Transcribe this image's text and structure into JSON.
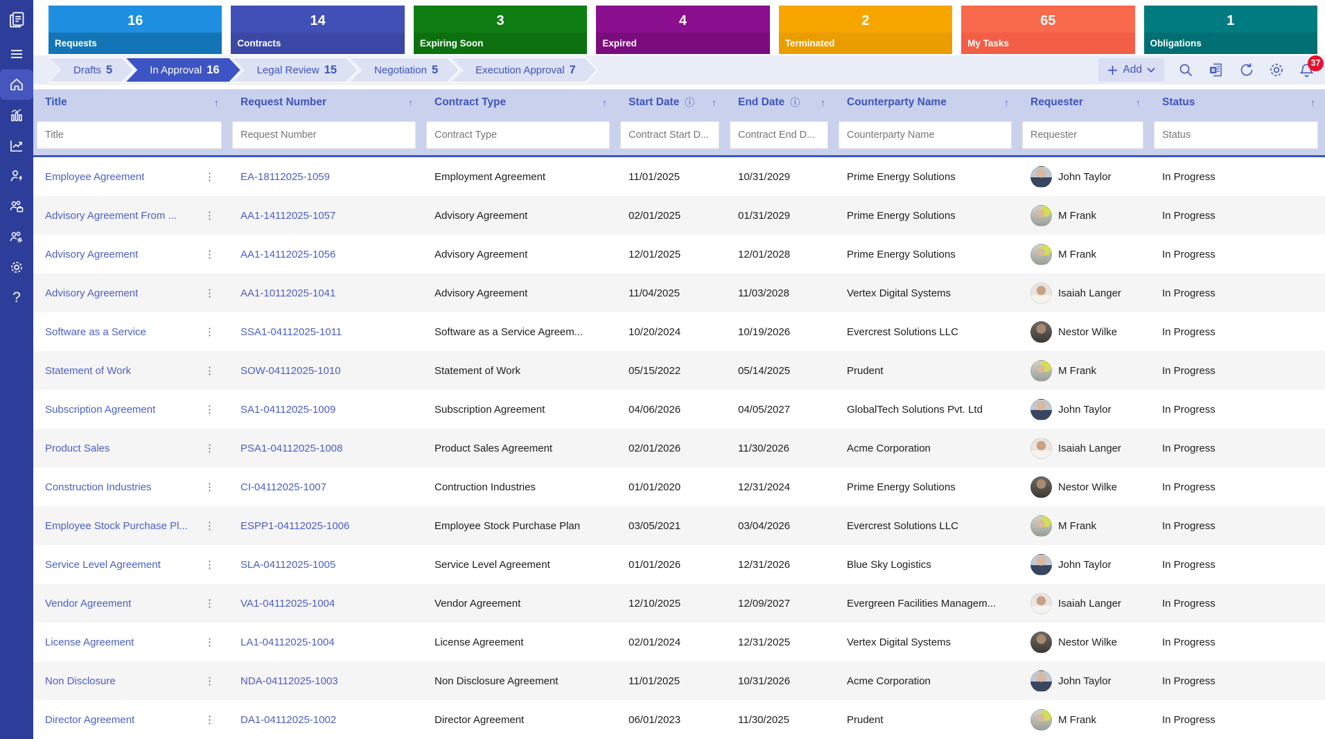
{
  "icons": {
    "sort": "↑",
    "info": "ⓘ",
    "kebab": "⋮",
    "chevron_down": "⌄",
    "plus": "+"
  },
  "sidebar": {
    "items": [
      "app-logo",
      "menu",
      "home",
      "analytics",
      "trend",
      "user-flash",
      "team-briefcase",
      "team-manage",
      "settings",
      "help"
    ],
    "active_item": "home",
    "help_glyph": "?"
  },
  "cards": [
    {
      "label": "Requests",
      "value": "16",
      "top": "#1E8FE1",
      "bottom": "#1375B5"
    },
    {
      "label": "Contracts",
      "value": "14",
      "top": "#4150B7",
      "bottom": "#3A47A5"
    },
    {
      "label": "Expiring Soon",
      "value": "3",
      "top": "#0F7E12",
      "bottom": "#0C700F"
    },
    {
      "label": "Expired",
      "value": "4",
      "top": "#8A0F8E",
      "bottom": "#7A0C7E"
    },
    {
      "label": "Terminated",
      "value": "2",
      "top": "#F7A600",
      "bottom": "#EA9D00"
    },
    {
      "label": "My Tasks",
      "value": "65",
      "top": "#F9694C",
      "bottom": "#F25F46"
    },
    {
      "label": "Obligations",
      "value": "1",
      "top": "#007B80",
      "bottom": "#006F73"
    }
  ],
  "pipeline": {
    "stages": [
      {
        "label": "Drafts",
        "count": "5",
        "active": false
      },
      {
        "label": "In Approval",
        "count": "16",
        "active": true
      },
      {
        "label": "Legal Review",
        "count": "15",
        "active": false
      },
      {
        "label": "Negotiation",
        "count": "5",
        "active": false
      },
      {
        "label": "Execution Approval",
        "count": "7",
        "active": false
      }
    ]
  },
  "toolbar": {
    "add_label": "Add",
    "notification_count": "37"
  },
  "table": {
    "columns": [
      {
        "label": "Title",
        "placeholder": "Title",
        "info": false
      },
      {
        "label": "Request Number",
        "placeholder": "Request Number",
        "info": false
      },
      {
        "label": "Contract Type",
        "placeholder": "Contract Type",
        "info": false
      },
      {
        "label": "Start Date",
        "placeholder": "Contract Start D...",
        "info": true
      },
      {
        "label": "End Date",
        "placeholder": "Contract End D...",
        "info": true
      },
      {
        "label": "Counterparty Name",
        "placeholder": "Counterparty Name",
        "info": false
      },
      {
        "label": "Requester",
        "placeholder": "Requester",
        "info": false
      },
      {
        "label": "Status",
        "placeholder": "Status",
        "info": false
      }
    ],
    "rows": [
      {
        "title": "Employee Agreement",
        "request_number": "EA-18112025-1059",
        "contract_type": "Employment Agreement",
        "start_date": "11/01/2025",
        "end_date": "10/31/2029",
        "counterparty": "Prime Energy Solutions",
        "requester": "John Taylor",
        "avatar": "john-taylor",
        "status": "In Progress"
      },
      {
        "title": "Advisory Agreement From ...",
        "request_number": "AA1-14112025-1057",
        "contract_type": "Advisory Agreement",
        "start_date": "02/01/2025",
        "end_date": "01/31/2029",
        "counterparty": "Prime Energy Solutions",
        "requester": "M Frank",
        "avatar": "m-frank",
        "status": "In Progress"
      },
      {
        "title": "Advisory Agreement",
        "request_number": "AA1-14112025-1056",
        "contract_type": "Advisory Agreement",
        "start_date": "12/01/2025",
        "end_date": "12/01/2028",
        "counterparty": "Prime Energy Solutions",
        "requester": "M Frank",
        "avatar": "m-frank",
        "status": "In Progress"
      },
      {
        "title": "Advisory Agreement",
        "request_number": "AA1-10112025-1041",
        "contract_type": "Advisory Agreement",
        "start_date": "11/04/2025",
        "end_date": "11/03/2028",
        "counterparty": "Vertex Digital Systems",
        "requester": "Isaiah Langer",
        "avatar": "isaiah-langer",
        "status": "In Progress"
      },
      {
        "title": "Software as a Service",
        "request_number": "SSA1-04112025-1011",
        "contract_type": "Software as a Service Agreem...",
        "start_date": "10/20/2024",
        "end_date": "10/19/2026",
        "counterparty": "Evercrest Solutions LLC",
        "requester": "Nestor Wilke",
        "avatar": "nestor-wilke",
        "status": "In Progress"
      },
      {
        "title": "Statement of Work",
        "request_number": "SOW-04112025-1010",
        "contract_type": "Statement of Work",
        "start_date": "05/15/2022",
        "end_date": "05/14/2025",
        "counterparty": "Prudent",
        "requester": "M Frank",
        "avatar": "m-frank",
        "status": "In Progress"
      },
      {
        "title": "Subscription Agreement",
        "request_number": "SA1-04112025-1009",
        "contract_type": "Subscription Agreement",
        "start_date": "04/06/2026",
        "end_date": "04/05/2027",
        "counterparty": "GlobalTech Solutions Pvt. Ltd",
        "requester": "John Taylor",
        "avatar": "john-taylor",
        "status": "In Progress"
      },
      {
        "title": "Product Sales",
        "request_number": "PSA1-04112025-1008",
        "contract_type": "Product Sales Agreement",
        "start_date": "02/01/2026",
        "end_date": "11/30/2026",
        "counterparty": "Acme Corporation",
        "requester": "Isaiah Langer",
        "avatar": "isaiah-langer",
        "status": "In Progress"
      },
      {
        "title": "Construction Industries",
        "request_number": "CI-04112025-1007",
        "contract_type": "Contruction Industries",
        "start_date": "01/01/2020",
        "end_date": "12/31/2024",
        "counterparty": "Prime Energy Solutions",
        "requester": "Nestor Wilke",
        "avatar": "nestor-wilke",
        "status": "In Progress"
      },
      {
        "title": "Employee Stock Purchase Pl...",
        "request_number": "ESPP1-04112025-1006",
        "contract_type": "Employee Stock Purchase Plan",
        "start_date": "03/05/2021",
        "end_date": "03/04/2026",
        "counterparty": "Evercrest Solutions LLC",
        "requester": "M Frank",
        "avatar": "m-frank",
        "status": "In Progress"
      },
      {
        "title": "Service Level Agreement",
        "request_number": "SLA-04112025-1005",
        "contract_type": "Service Level Agreement",
        "start_date": "01/01/2026",
        "end_date": "12/31/2026",
        "counterparty": "Blue Sky Logistics",
        "requester": "John Taylor",
        "avatar": "john-taylor",
        "status": "In Progress"
      },
      {
        "title": "Vendor Agreement",
        "request_number": "VA1-04112025-1004",
        "contract_type": "Vendor Agreement",
        "start_date": "12/10/2025",
        "end_date": "12/09/2027",
        "counterparty": "Evergreen Facilities Managem...",
        "requester": "Isaiah Langer",
        "avatar": "isaiah-langer",
        "status": "In Progress"
      },
      {
        "title": "License Agreement",
        "request_number": "LA1-04112025-1004",
        "contract_type": "License Agreement",
        "start_date": "02/01/2024",
        "end_date": "12/31/2025",
        "counterparty": "Vertex Digital Systems",
        "requester": "Nestor Wilke",
        "avatar": "nestor-wilke",
        "status": "In Progress"
      },
      {
        "title": "Non Disclosure",
        "request_number": "NDA-04112025-1003",
        "contract_type": "Non Disclosure Agreement",
        "start_date": "11/01/2025",
        "end_date": "10/31/2026",
        "counterparty": "Acme Corporation",
        "requester": "John Taylor",
        "avatar": "john-taylor",
        "status": "In Progress"
      },
      {
        "title": "Director Agreement",
        "request_number": "DA1-04112025-1002",
        "contract_type": "Director Agreement",
        "start_date": "06/01/2023",
        "end_date": "11/30/2025",
        "counterparty": "Prudent",
        "requester": "M Frank",
        "avatar": "m-frank",
        "status": "In Progress"
      }
    ]
  }
}
